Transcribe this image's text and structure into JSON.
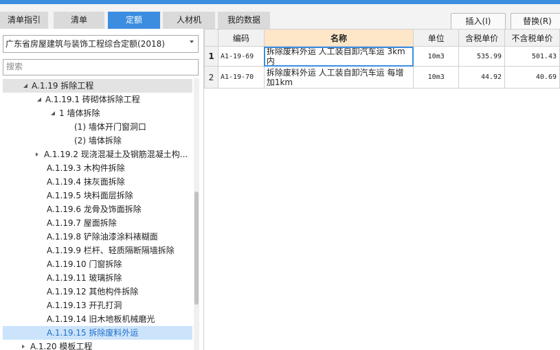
{
  "tabs": [
    {
      "label": "清单指引"
    },
    {
      "label": "清单"
    },
    {
      "label": "定额"
    },
    {
      "label": "人材机"
    },
    {
      "label": "我的数据"
    }
  ],
  "active_tab": "定额",
  "toolbar": {
    "insert_label": "插入(I)",
    "replace_label": "替换(R)"
  },
  "left": {
    "library_select": "广东省房屋建筑与装饰工程综合定额(2018)",
    "search_placeholder": "搜索"
  },
  "tree": [
    {
      "label": "A.1.19 拆除工程"
    },
    {
      "label": "A.1.19.1 砖砌体拆除工程"
    },
    {
      "label": "1 墙体拆除"
    },
    {
      "label": "(1) 墙体开门窗洞口"
    },
    {
      "label": "(2) 墙体拆除"
    },
    {
      "label": "A.1.19.2 现浇混凝土及钢筋混凝土构..."
    },
    {
      "label": "A.1.19.3 木构件拆除"
    },
    {
      "label": "A.1.19.4 抹灰面拆除"
    },
    {
      "label": "A.1.19.5 块料面层拆除"
    },
    {
      "label": "A.1.19.6 龙骨及饰面拆除"
    },
    {
      "label": "A.1.19.7 屋面拆除"
    },
    {
      "label": "A.1.19.8 铲除油漆涂料裱糊面"
    },
    {
      "label": "A.1.19.9 栏杆、轻质隔断隔墙拆除"
    },
    {
      "label": "A.1.19.10 门窗拆除"
    },
    {
      "label": "A.1.19.11 玻璃拆除"
    },
    {
      "label": "A.1.19.12 其他构件拆除"
    },
    {
      "label": "A.1.19.13 开孔打洞"
    },
    {
      "label": "A.1.19.14 旧木地板机械磨光"
    },
    {
      "label": "A.1.19.15 拆除废料外运"
    },
    {
      "label": "A.1.20 模板工程"
    }
  ],
  "table": {
    "headers": {
      "code": "编码",
      "name": "名称",
      "unit": "单位",
      "tax_price": "含税单价",
      "notax_price": "不含税单价"
    },
    "rows": [
      {
        "no": "1",
        "code": "A1-19-69",
        "name": "拆除废料外运 人工装自卸汽车运 3km内",
        "unit": "10m3",
        "tax_price": "535.99",
        "notax_price": "501.43"
      },
      {
        "no": "2",
        "code": "A1-19-70",
        "name": "拆除废料外运 人工装自卸汽车运 每增加1km",
        "unit": "10m3",
        "tax_price": "44.92",
        "notax_price": "40.69"
      }
    ]
  },
  "colors": {
    "accent": "#3c8de0",
    "selected_row": "#cce4fb",
    "name_header": "#fde7c8"
  }
}
